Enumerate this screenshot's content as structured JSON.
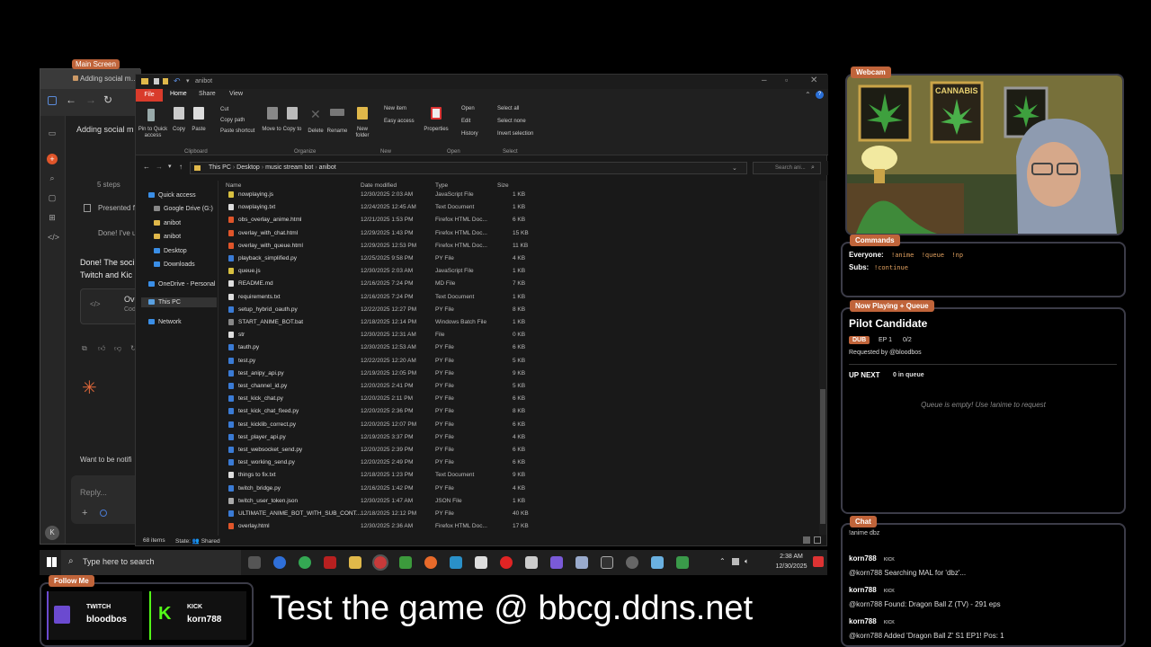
{
  "browser": {
    "tab_title": "Adding social media links with",
    "main_screen_badge": "Main Screen",
    "heading": "Adding social m",
    "steps": "5 steps",
    "presented": "Presented f",
    "done_short": "Done! I've u",
    "done_body_1": "Done! The soci",
    "done_body_2": "Twitch and Kic",
    "card_title": "Ove",
    "card_sub": "Cod",
    "notify": "Want to be notifi",
    "reply": "Reply..."
  },
  "explorer": {
    "window_title": "anibot",
    "ribbon_tabs": [
      "File",
      "Home",
      "Share",
      "View"
    ],
    "ribbon": {
      "pin": "Pin to Quick access",
      "copy": "Copy",
      "paste": "Paste",
      "cut": "Cut",
      "copy_path": "Copy path",
      "paste_shortcut": "Paste shortcut",
      "move_to": "Move to",
      "copy_to": "Copy to",
      "delete": "Delete",
      "rename": "Rename",
      "new_folder": "New folder",
      "new_item": "New item",
      "easy_access": "Easy access",
      "properties": "Properties",
      "open": "Open",
      "edit": "Edit",
      "history": "History",
      "select_all": "Select all",
      "select_none": "Select none",
      "invert_selection": "Invert selection",
      "groups": [
        "Clipboard",
        "Organize",
        "New",
        "Open",
        "Select"
      ]
    },
    "breadcrumb": [
      "This PC",
      "Desktop",
      "music stream bot",
      "anibot"
    ],
    "search_placeholder": "Search ani...",
    "nav": [
      "Quick access",
      "Google Drive (G:)",
      "anibot",
      "anibot",
      "Desktop",
      "Downloads",
      "OneDrive - Personal",
      "This PC",
      "Network"
    ],
    "columns": [
      "Name",
      "Date modified",
      "Type",
      "Size"
    ],
    "files": [
      {
        "name": "nowplaying.js",
        "date": "12/30/2025 2:03 AM",
        "type": "JavaScript File",
        "size": "1 KB"
      },
      {
        "name": "nowplaying.txt",
        "date": "12/24/2025 12:45 AM",
        "type": "Text Document",
        "size": "1 KB"
      },
      {
        "name": "obs_overlay_anime.html",
        "date": "12/21/2025 1:53 PM",
        "type": "Firefox HTML Doc...",
        "size": "6 KB"
      },
      {
        "name": "overlay_with_chat.html",
        "date": "12/29/2025 1:43 PM",
        "type": "Firefox HTML Doc...",
        "size": "15 KB"
      },
      {
        "name": "overlay_with_queue.html",
        "date": "12/29/2025 12:53 PM",
        "type": "Firefox HTML Doc...",
        "size": "11 KB"
      },
      {
        "name": "playback_simplified.py",
        "date": "12/25/2025 9:58 PM",
        "type": "PY File",
        "size": "4 KB"
      },
      {
        "name": "queue.js",
        "date": "12/30/2025 2:03 AM",
        "type": "JavaScript File",
        "size": "1 KB"
      },
      {
        "name": "README.md",
        "date": "12/16/2025 7:24 PM",
        "type": "MD File",
        "size": "7 KB"
      },
      {
        "name": "requirements.txt",
        "date": "12/16/2025 7:24 PM",
        "type": "Text Document",
        "size": "1 KB"
      },
      {
        "name": "setup_hybrid_oauth.py",
        "date": "12/22/2025 12:27 PM",
        "type": "PY File",
        "size": "8 KB"
      },
      {
        "name": "START_ANIME_BOT.bat",
        "date": "12/18/2025 12:14 PM",
        "type": "Windows Batch File",
        "size": "1 KB"
      },
      {
        "name": "str",
        "date": "12/30/2025 12:31 AM",
        "type": "File",
        "size": "0 KB"
      },
      {
        "name": "tauth.py",
        "date": "12/30/2025 12:53 AM",
        "type": "PY File",
        "size": "6 KB"
      },
      {
        "name": "test.py",
        "date": "12/22/2025 12:20 AM",
        "type": "PY File",
        "size": "5 KB"
      },
      {
        "name": "test_anipy_api.py",
        "date": "12/19/2025 12:05 PM",
        "type": "PY File",
        "size": "9 KB"
      },
      {
        "name": "test_channel_id.py",
        "date": "12/20/2025 2:41 PM",
        "type": "PY File",
        "size": "5 KB"
      },
      {
        "name": "test_kick_chat.py",
        "date": "12/20/2025 2:11 PM",
        "type": "PY File",
        "size": "6 KB"
      },
      {
        "name": "test_kick_chat_fixed.py",
        "date": "12/20/2025 2:36 PM",
        "type": "PY File",
        "size": "8 KB"
      },
      {
        "name": "test_kicklib_correct.py",
        "date": "12/20/2025 12:07 PM",
        "type": "PY File",
        "size": "6 KB"
      },
      {
        "name": "test_player_api.py",
        "date": "12/19/2025 3:37 PM",
        "type": "PY File",
        "size": "4 KB"
      },
      {
        "name": "test_websocket_send.py",
        "date": "12/20/2025 2:39 PM",
        "type": "PY File",
        "size": "6 KB"
      },
      {
        "name": "test_working_send.py",
        "date": "12/20/2025 2:49 PM",
        "type": "PY File",
        "size": "6 KB"
      },
      {
        "name": "things to fix.txt",
        "date": "12/18/2025 1:23 PM",
        "type": "Text Document",
        "size": "9 KB"
      },
      {
        "name": "twitch_bridge.py",
        "date": "12/16/2025 1:42 PM",
        "type": "PY File",
        "size": "4 KB"
      },
      {
        "name": "twitch_user_token.json",
        "date": "12/30/2025 1:47 AM",
        "type": "JSON File",
        "size": "1 KB"
      },
      {
        "name": "ULTIMATE_ANIME_BOT_WITH_SUB_CONT...",
        "date": "12/18/2025 12:12 PM",
        "type": "PY File",
        "size": "40 KB"
      },
      {
        "name": "overlay.html",
        "date": "12/30/2025 2:36 AM",
        "type": "Firefox HTML Doc...",
        "size": "17 KB"
      }
    ],
    "status_items": "68 items",
    "status_state": "State: 👥 Shared"
  },
  "taskbar": {
    "search_placeholder": "Type here to search",
    "time": "2:38 AM",
    "date": "12/30/2025"
  },
  "overlay": {
    "webcam_label": "Webcam",
    "poster_text": "CANNABIS",
    "commands_label": "Commands",
    "everyone_label": "Everyone:",
    "everyone_cmds": "!anime  !queue  !np",
    "subs_label": "Subs:",
    "subs_cmds": "!continue",
    "np_label": "Now Playing + Queue",
    "np_title": "Pilot Candidate",
    "np_badge": "DUB",
    "np_ep": "EP 1",
    "np_progress": "0/2",
    "np_requested": "Requested by @bloodbos",
    "up_next": "UP NEXT",
    "in_queue": "0 in queue",
    "queue_empty": "Queue is empty! Use !anime to request",
    "chat_label": "Chat",
    "chat_cut": "!anime dbz",
    "chat": [
      {
        "user": "korn788",
        "platform": "KICK",
        "msg": "@korn788 Searching MAL for 'dbz'..."
      },
      {
        "user": "korn788",
        "platform": "KICK",
        "msg": "@korn788 Found: Dragon Ball Z (TV) - 291 eps"
      },
      {
        "user": "korn788",
        "platform": "KICK",
        "msg": "@korn788 Added 'Dragon Ball Z' S1 EP1! Pos: 1"
      }
    ],
    "follow_label": "Follow Me",
    "twitch_label": "TWITCH",
    "twitch_user": "bloodbos",
    "kick_label": "KICK",
    "kick_user": "korn788",
    "banner": "Test the game @ bbcg.ddns.net"
  },
  "colors": {
    "accent": "#c0643a",
    "panel_border": "#3c3c48",
    "file_tab": "#d93b2b"
  }
}
